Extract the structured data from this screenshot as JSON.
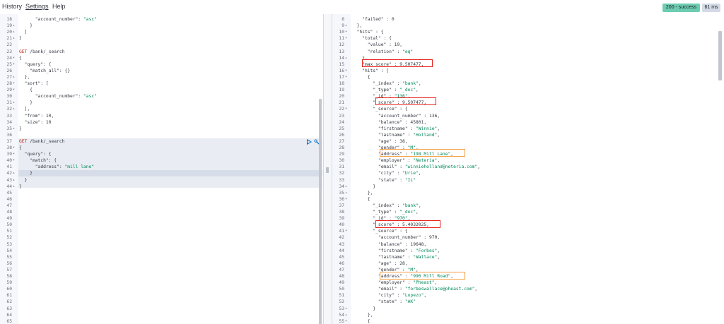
{
  "menu": {
    "history": "History",
    "settings": "Settings",
    "help": "Help"
  },
  "status": {
    "code": "200 - success",
    "time": "61 ms"
  },
  "colors": {
    "success_badge": "#6dccb1",
    "time_badge": "#d3dae6",
    "string_token": "#00875a",
    "method_token": "#bd271e",
    "highlight_red": "#e7231e",
    "highlight_orange": "#f59e42"
  },
  "editor": {
    "lines": [
      {
        "n": "18",
        "f": "",
        "t": "      \"account_number\": \"asc\""
      },
      {
        "n": "19",
        "f": "▴",
        "t": "    }"
      },
      {
        "n": "20",
        "f": "▴",
        "t": "  ]"
      },
      {
        "n": "21",
        "f": "▴",
        "t": "}"
      },
      {
        "n": "22",
        "f": "",
        "t": ""
      },
      {
        "n": "23",
        "f": "",
        "t": "GET /bank/_search"
      },
      {
        "n": "24",
        "f": "▾",
        "t": "{"
      },
      {
        "n": "25",
        "f": "▾",
        "t": "  \"query\": {"
      },
      {
        "n": "26",
        "f": "",
        "t": "    \"match_all\": {}"
      },
      {
        "n": "27",
        "f": "▴",
        "t": "  },"
      },
      {
        "n": "28",
        "f": "▾",
        "t": "  \"sort\": ["
      },
      {
        "n": "29",
        "f": "▾",
        "t": "    {"
      },
      {
        "n": "30",
        "f": "",
        "t": "      \"account_number\": \"asc\""
      },
      {
        "n": "31",
        "f": "▴",
        "t": "    }"
      },
      {
        "n": "32",
        "f": "▴",
        "t": "  ],"
      },
      {
        "n": "33",
        "f": "",
        "t": "  \"from\": 10,"
      },
      {
        "n": "34",
        "f": "",
        "t": "  \"size\": 10"
      },
      {
        "n": "35",
        "f": "▴",
        "t": "}"
      },
      {
        "n": "36",
        "f": "",
        "t": ""
      },
      {
        "n": "37",
        "f": "",
        "t": "GET /bank/_search"
      },
      {
        "n": "38",
        "f": "▾",
        "t": "{"
      },
      {
        "n": "39",
        "f": "▾",
        "t": "  \"query\": {"
      },
      {
        "n": "40",
        "f": "▾",
        "t": "    \"match\": {"
      },
      {
        "n": "41",
        "f": "",
        "t": "      \"address\": \"mill lane\""
      },
      {
        "n": "42",
        "f": "▴",
        "t": "    }"
      },
      {
        "n": "43",
        "f": "▴",
        "t": "  }"
      },
      {
        "n": "44",
        "f": "▴",
        "t": "}"
      },
      {
        "n": "45",
        "f": "",
        "t": ""
      },
      {
        "n": "46",
        "f": "",
        "t": ""
      },
      {
        "n": "47",
        "f": "",
        "t": ""
      },
      {
        "n": "48",
        "f": "",
        "t": ""
      },
      {
        "n": "49",
        "f": "",
        "t": ""
      },
      {
        "n": "50",
        "f": "",
        "t": ""
      },
      {
        "n": "51",
        "f": "",
        "t": ""
      },
      {
        "n": "52",
        "f": "",
        "t": ""
      },
      {
        "n": "53",
        "f": "",
        "t": ""
      },
      {
        "n": "54",
        "f": "",
        "t": ""
      },
      {
        "n": "55",
        "f": "",
        "t": ""
      },
      {
        "n": "56",
        "f": "",
        "t": ""
      },
      {
        "n": "57",
        "f": "",
        "t": ""
      },
      {
        "n": "58",
        "f": "",
        "t": ""
      },
      {
        "n": "59",
        "f": "",
        "t": ""
      },
      {
        "n": "60",
        "f": "",
        "t": ""
      },
      {
        "n": "61",
        "f": "",
        "t": ""
      },
      {
        "n": "62",
        "f": "",
        "t": ""
      },
      {
        "n": "63",
        "f": "",
        "t": ""
      },
      {
        "n": "64",
        "f": "",
        "t": ""
      },
      {
        "n": "65",
        "f": "",
        "t": ""
      }
    ]
  },
  "response": {
    "lines": [
      {
        "n": "8",
        "f": "",
        "t": "    \"failed\" : 0"
      },
      {
        "n": "9",
        "f": "▴",
        "t": "  },"
      },
      {
        "n": "10",
        "f": "▾",
        "t": "  \"hits\" : {"
      },
      {
        "n": "11",
        "f": "▾",
        "t": "    \"total\" : {"
      },
      {
        "n": "12",
        "f": "",
        "t": "      \"value\" : 19,"
      },
      {
        "n": "13",
        "f": "",
        "t": "      \"relation\" : \"eq\""
      },
      {
        "n": "14",
        "f": "▴",
        "t": "    },"
      },
      {
        "n": "15",
        "f": "",
        "t": "    \"max_score\" : 9.507477,"
      },
      {
        "n": "16",
        "f": "▾",
        "t": "    \"hits\" : ["
      },
      {
        "n": "17",
        "f": "▾",
        "t": "      {"
      },
      {
        "n": "18",
        "f": "",
        "t": "        \"_index\" : \"bank\","
      },
      {
        "n": "19",
        "f": "",
        "t": "        \"_type\" : \"_doc\","
      },
      {
        "n": "20",
        "f": "",
        "t": "        \"_id\" : \"136\","
      },
      {
        "n": "21",
        "f": "",
        "t": "        \"_score\" : 9.507477,"
      },
      {
        "n": "22",
        "f": "▾",
        "t": "        \"_source\" : {"
      },
      {
        "n": "23",
        "f": "",
        "t": "          \"account_number\" : 136,"
      },
      {
        "n": "24",
        "f": "",
        "t": "          \"balance\" : 45801,"
      },
      {
        "n": "25",
        "f": "",
        "t": "          \"firstname\" : \"Winnie\","
      },
      {
        "n": "26",
        "f": "",
        "t": "          \"lastname\" : \"Holland\","
      },
      {
        "n": "27",
        "f": "",
        "t": "          \"age\" : 38,"
      },
      {
        "n": "28",
        "f": "",
        "t": "          \"gender\" : \"M\","
      },
      {
        "n": "29",
        "f": "",
        "t": "          \"address\" : \"198 Mill Lane\","
      },
      {
        "n": "30",
        "f": "",
        "t": "          \"employer\" : \"Neteria\","
      },
      {
        "n": "31",
        "f": "",
        "t": "          \"email\" : \"winnieholland@neteria.com\","
      },
      {
        "n": "32",
        "f": "",
        "t": "          \"city\" : \"Urie\","
      },
      {
        "n": "33",
        "f": "",
        "t": "          \"state\" : \"IL\""
      },
      {
        "n": "34",
        "f": "▴",
        "t": "        }"
      },
      {
        "n": "35",
        "f": "▴",
        "t": "      },"
      },
      {
        "n": "36",
        "f": "▾",
        "t": "      {"
      },
      {
        "n": "37",
        "f": "",
        "t": "        \"_index\" : \"bank\","
      },
      {
        "n": "38",
        "f": "",
        "t": "        \"_type\" : \"_doc\","
      },
      {
        "n": "39",
        "f": "",
        "t": "        \"_id\" : \"970\","
      },
      {
        "n": "40",
        "f": "",
        "t": "        \"_score\" : 5.4032025,"
      },
      {
        "n": "41",
        "f": "▾",
        "t": "        \"_source\" : {"
      },
      {
        "n": "42",
        "f": "",
        "t": "          \"account_number\" : 970,"
      },
      {
        "n": "43",
        "f": "",
        "t": "          \"balance\" : 19648,"
      },
      {
        "n": "44",
        "f": "",
        "t": "          \"firstname\" : \"Forbes\","
      },
      {
        "n": "45",
        "f": "",
        "t": "          \"lastname\" : \"Wallace\","
      },
      {
        "n": "46",
        "f": "",
        "t": "          \"age\" : 28,"
      },
      {
        "n": "47",
        "f": "",
        "t": "          \"gender\" : \"M\","
      },
      {
        "n": "48",
        "f": "",
        "t": "          \"address\" : \"990 Mill Road\","
      },
      {
        "n": "49",
        "f": "",
        "t": "          \"employer\" : \"Pheast\","
      },
      {
        "n": "50",
        "f": "",
        "t": "          \"email\" : \"forbeswallace@pheast.com\","
      },
      {
        "n": "51",
        "f": "",
        "t": "          \"city\" : \"Lopezo\","
      },
      {
        "n": "52",
        "f": "",
        "t": "          \"state\" : \"AK\""
      },
      {
        "n": "53",
        "f": "▴",
        "t": "        }"
      },
      {
        "n": "54",
        "f": "▴",
        "t": "      },"
      },
      {
        "n": "55",
        "f": "▾",
        "t": "      {"
      }
    ]
  }
}
